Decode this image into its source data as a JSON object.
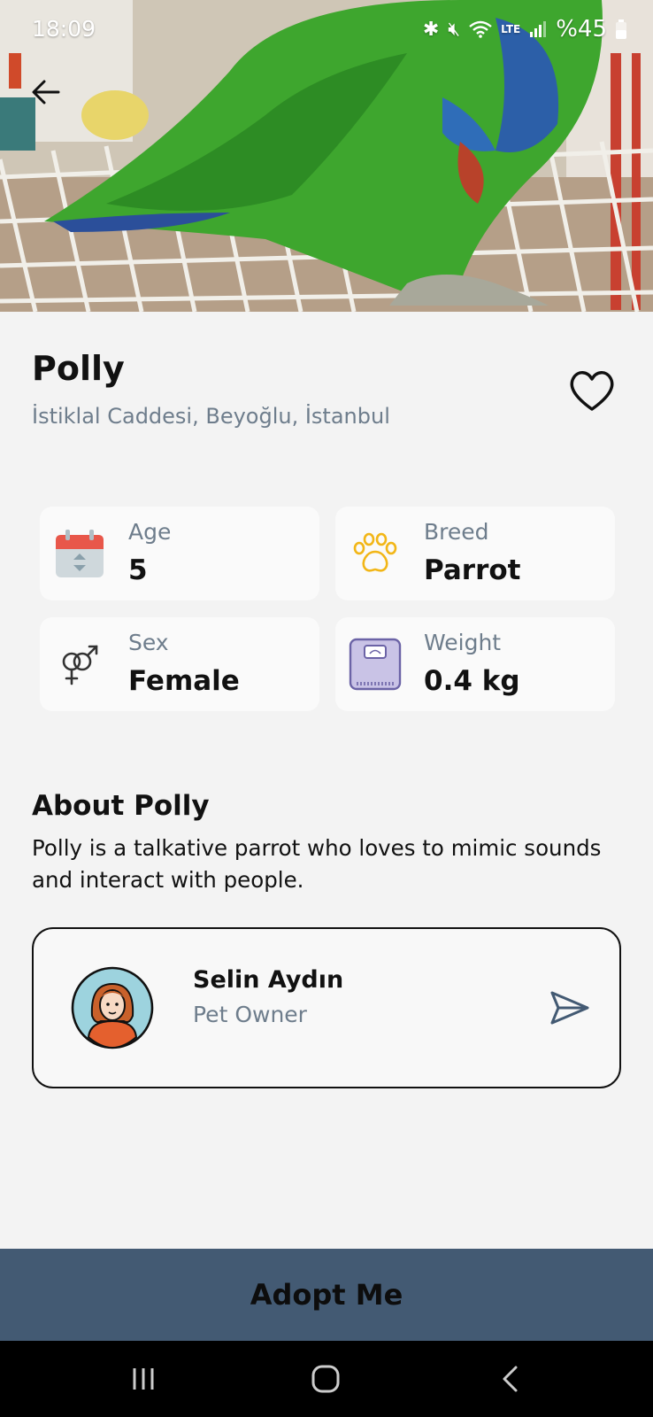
{
  "status_bar": {
    "time": "18:09",
    "battery": "%45",
    "network": "LTE"
  },
  "pet": {
    "name": "Polly",
    "location": "İstiklal Caddesi, Beyoğlu, İstanbul"
  },
  "stats": [
    {
      "label": "Age",
      "value": "5",
      "icon": "calendar-icon"
    },
    {
      "label": "Breed",
      "value": "Parrot",
      "icon": "paw-icon"
    },
    {
      "label": "Sex",
      "value": "Female",
      "icon": "gender-icon"
    },
    {
      "label": "Weight",
      "value": "0.4 kg",
      "icon": "scale-icon"
    }
  ],
  "about": {
    "title": "About Polly",
    "text": "Polly is a talkative parrot who loves to mimic sounds and interact with people."
  },
  "owner": {
    "name": "Selin Aydın",
    "role": "Pet Owner"
  },
  "actions": {
    "adopt_label": "Adopt Me"
  },
  "colors": {
    "adopt_button": "#435a73",
    "muted_text": "#6e7d8c",
    "background": "#f3f3f3",
    "card": "#fafafa"
  }
}
